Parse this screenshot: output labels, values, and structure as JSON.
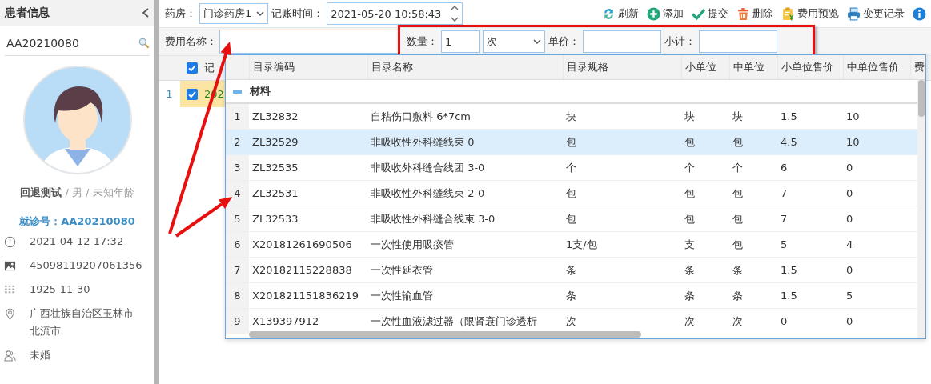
{
  "sidebar": {
    "title": "患者信息",
    "search_value": "AA20210080",
    "patient": "**回退测试** / 男 / 未知年龄",
    "visit_no": "就诊号：AA20210080",
    "details": [
      {
        "kind": "time",
        "text": "2021-04-12 17:32"
      },
      {
        "kind": "id",
        "text": "45098119207061356"
      },
      {
        "kind": "birth",
        "text": "1925-11-30"
      },
      {
        "kind": "address",
        "text": "广西壮族自治区玉林市北流市"
      },
      {
        "kind": "marital",
        "text": "未婚"
      }
    ]
  },
  "toolbar": {
    "pharmacy_label": "药房：",
    "pharmacy_value": "门诊药房1",
    "time_label": "记账时间：",
    "time_value": "2021-05-20 10:58:43",
    "actions": [
      {
        "kind": "refresh",
        "label": "刷新"
      },
      {
        "kind": "add",
        "label": "添加"
      },
      {
        "kind": "submit",
        "label": "提交"
      },
      {
        "kind": "delete",
        "label": "删除"
      },
      {
        "kind": "preview",
        "label": "费用预览"
      },
      {
        "kind": "history",
        "label": "变更记录"
      },
      {
        "kind": "info"
      }
    ]
  },
  "entry": {
    "name_label": "费用名称：",
    "quantity_label": "数量：",
    "quantity_value": "1",
    "unit_value": "次",
    "price_label": "单价：",
    "subtotal_label": "小计："
  },
  "grid": {
    "header_checked": true,
    "header_label": "记",
    "rows": [
      {
        "number": "1",
        "checked": true,
        "cell": "202",
        "selected": true
      }
    ]
  },
  "dropdown": {
    "columns": [
      "目录编码",
      "目录名称",
      "目录规格",
      "小单位",
      "中单位",
      "小单位售价",
      "中单位售价",
      "费"
    ],
    "group": {
      "label": "材料",
      "expanded": true
    },
    "rows": [
      {
        "number": "1",
        "selected": false,
        "cells": [
          "ZL32832",
          "自粘伤口敷料 6*7cm",
          "块",
          "块",
          "块",
          "1.5",
          "10"
        ]
      },
      {
        "number": "2",
        "selected": true,
        "cells": [
          "ZL32529",
          "非吸收性外科缝线束 0",
          "包",
          "包",
          "包",
          "4.5",
          "10"
        ]
      },
      {
        "number": "3",
        "selected": false,
        "cells": [
          "ZL32535",
          "非吸收外科缝合线团 3-0",
          "个",
          "个",
          "个",
          "6",
          "0"
        ]
      },
      {
        "number": "4",
        "selected": false,
        "cells": [
          "ZL32531",
          "非吸收性外科缝线束 2-0",
          "包",
          "包",
          "包",
          "7",
          "0"
        ]
      },
      {
        "number": "5",
        "selected": false,
        "cells": [
          "ZL32533",
          "非吸收性外科缝合线束 3-0",
          "包",
          "包",
          "包",
          "7",
          "0"
        ]
      },
      {
        "number": "6",
        "selected": false,
        "cells": [
          "X20181261690506",
          "一次性使用吸痰管",
          "1支/包",
          "支",
          "包",
          "5",
          "4"
        ]
      },
      {
        "number": "7",
        "selected": false,
        "cells": [
          "X20182115228838",
          "一次性延衣管",
          "条",
          "条",
          "条",
          "1.5",
          "0"
        ]
      },
      {
        "number": "8",
        "selected": false,
        "cells": [
          "X201821151836219",
          "一次性输血管",
          "条",
          "条",
          "条",
          "1.5",
          "5"
        ]
      },
      {
        "number": "9",
        "selected": false,
        "cells": [
          "X139397912",
          "一次性血液滤过器（限肾衰门诊透析",
          "次",
          "次",
          "次",
          "0",
          "0"
        ]
      }
    ]
  }
}
